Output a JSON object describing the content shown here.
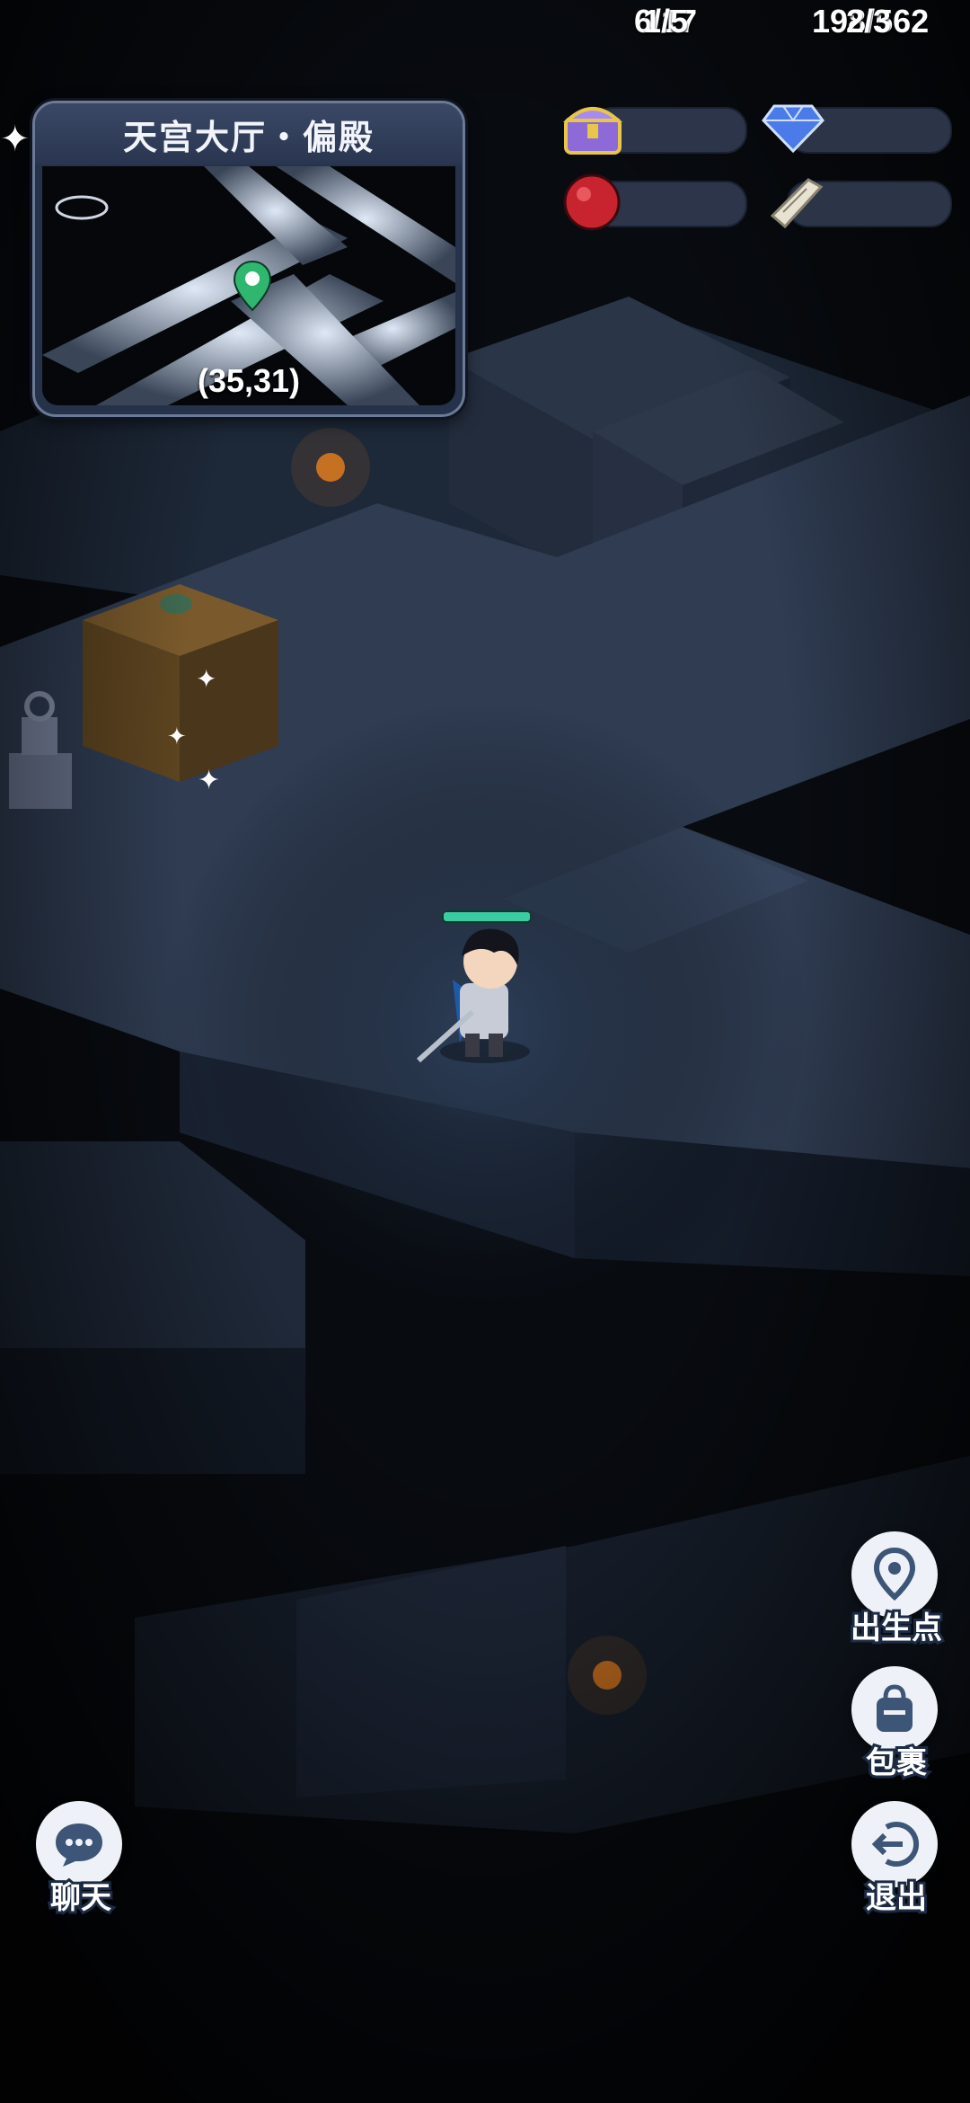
{
  "minimap": {
    "title": "天宫大厅・偏殿",
    "coords": "(35,31)"
  },
  "resources": {
    "chests": "6/17",
    "diamonds": "198/562",
    "orbs": "1/5",
    "scrolls": "2/3"
  },
  "buttons": {
    "spawn": "出生点",
    "bag": "包裹",
    "exit": "退出",
    "chat": "聊天"
  },
  "player": {
    "health": 1.0
  },
  "colors": {
    "accent": "#3ccaa0",
    "marker": "#2fb76f",
    "diamond": "#4a7be8",
    "orb": "#c8242f",
    "chest": "#8e6ad8"
  },
  "icons": {
    "chest": "treasure-chest-icon",
    "diamond": "diamond-icon",
    "orb": "red-orb-icon",
    "scroll": "scroll-icon",
    "spawn": "location-pin-icon",
    "bag": "backpack-icon",
    "exit": "exit-arrow-icon",
    "chat": "chat-bubble-icon"
  }
}
